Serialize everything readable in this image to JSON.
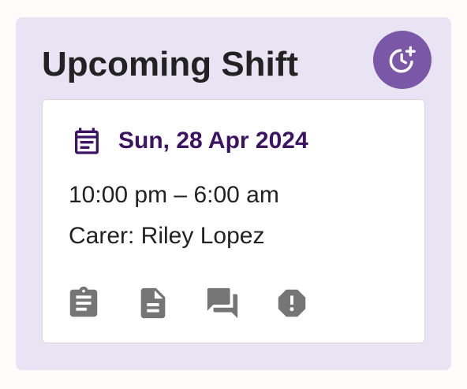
{
  "shift_panel": {
    "title": "Upcoming Shift",
    "add_button_icon": "schedule-add-icon",
    "accent_color": "#7b57a8",
    "background_color": "#e8e4f3"
  },
  "shift_card": {
    "date_icon": "calendar-icon",
    "date": "Sun, 28 Apr 2024",
    "date_color": "#3d1463",
    "time_range": "10:00 pm – 6:00 am",
    "carer": "Carer: Riley Lopez",
    "actions": [
      {
        "icon": "clipboard-icon"
      },
      {
        "icon": "document-icon"
      },
      {
        "icon": "chat-icon"
      },
      {
        "icon": "alert-icon"
      }
    ]
  }
}
